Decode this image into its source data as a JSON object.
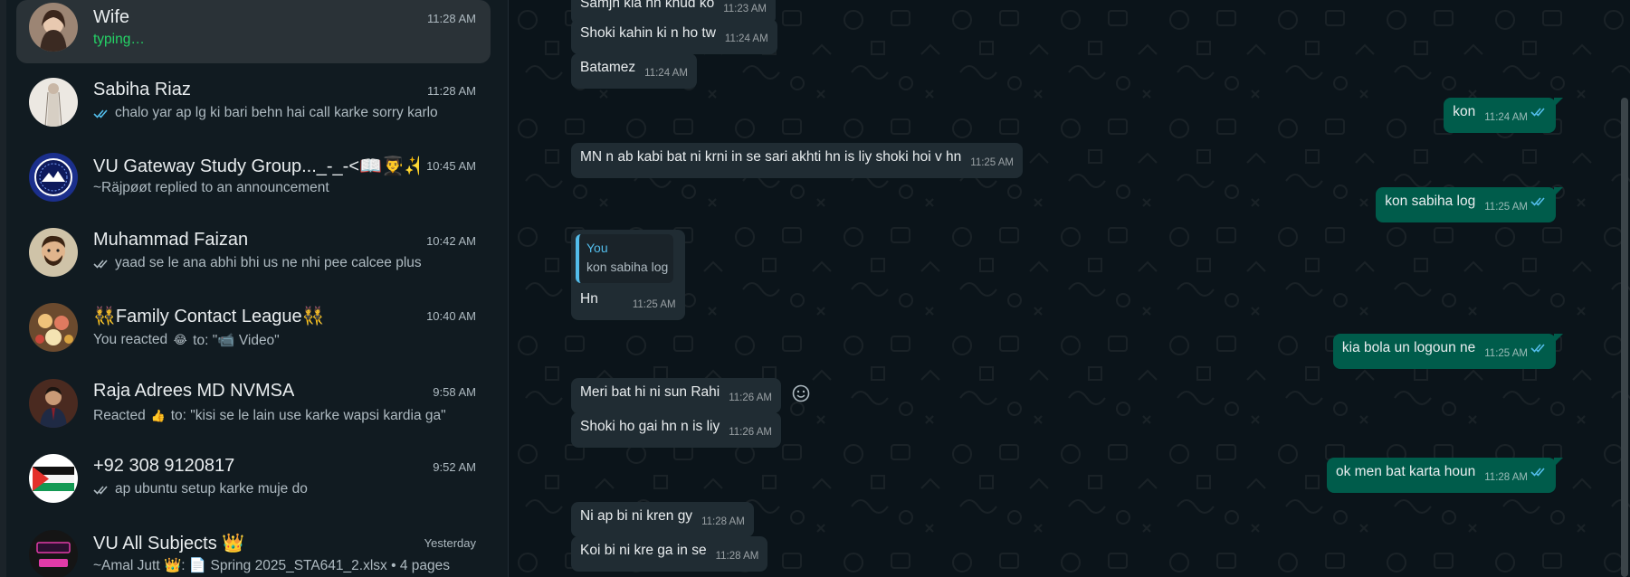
{
  "sidebar": {
    "chats": [
      {
        "name": "Wife",
        "time": "11:28 AM",
        "preview": "typing…",
        "typing": true,
        "ticks": false
      },
      {
        "name": "Sabiha Riaz",
        "time": "11:28 AM",
        "preview": "chalo yar ap lg ki bari behn hai call karke sorry karlo",
        "ticks": true,
        "tick_color": "#53bdeb"
      },
      {
        "name": "VU Gateway Study Group..._-_-<📖👨‍🎓✨...",
        "time": "10:45 AM",
        "preview": "~Räjpøøt replied to an announcement",
        "ticks": false
      },
      {
        "name": "Muhammad Faizan",
        "time": "10:42 AM",
        "preview": "yaad se le ana abhi bhi us ne nhi pee calcee plus",
        "ticks": true,
        "tick_color": "#aebac1"
      },
      {
        "name": "👯Family Contact League👯",
        "time": "10:40 AM",
        "preview_prefix": "You reacted",
        "preview_emoji": "😂",
        "preview_suffix": "to: \"📹 Video\"",
        "ticks": false
      },
      {
        "name": "Raja Adrees MD NVMSA",
        "time": "9:58 AM",
        "preview_prefix": "Reacted",
        "preview_emoji": "👍",
        "preview_suffix": "to: \"kisi se le lain use karke wapsi kardia ga\"",
        "ticks": false
      },
      {
        "name": "+92 308 9120817",
        "time": "9:52 AM",
        "preview": "ap ubuntu setup karke muje do",
        "ticks": true,
        "tick_color": "#aebac1"
      },
      {
        "name": "VU All Subjects 👑",
        "time": "Yesterday",
        "preview": "~Amal Jutt 👑: 📄 Spring 2025_STA641_2.xlsx • 4 pages",
        "ticks": false
      }
    ]
  },
  "conversation": {
    "messages": [
      {
        "dir": "in",
        "text": "Samjh kia hn khud ko",
        "time": "11:23 AM"
      },
      {
        "dir": "in",
        "text": "Shoki kahin ki n ho tw",
        "time": "11:24 AM"
      },
      {
        "dir": "in",
        "text": "Batamez",
        "time": "11:24 AM"
      },
      {
        "dir": "out",
        "text": "kon",
        "time": "11:24 AM"
      },
      {
        "dir": "in",
        "text": "MN n ab kabi bat ni krni in se sari akhti hn is liy shoki hoi v hn",
        "time": "11:25 AM"
      },
      {
        "dir": "out",
        "text": "kon sabiha log",
        "time": "11:25 AM"
      },
      {
        "dir": "in",
        "quote_author": "You",
        "quote_text": "kon sabiha log",
        "text": "Hn",
        "time": "11:25 AM"
      },
      {
        "dir": "out",
        "text": "kia bola un logoun ne",
        "time": "11:25 AM"
      },
      {
        "dir": "in",
        "text": "Meri bat hi ni sun Rahi",
        "time": "11:26 AM"
      },
      {
        "dir": "in",
        "text": "Shoki ho gai hn n is liy",
        "time": "11:26 AM"
      },
      {
        "dir": "out",
        "text": "ok men bat karta houn",
        "time": "11:28 AM"
      },
      {
        "dir": "in",
        "text": "Ni ap bi ni kren gy",
        "time": "11:28 AM"
      },
      {
        "dir": "in",
        "text": "Koi bi ni kre ga in se",
        "time": "11:28 AM"
      }
    ]
  },
  "colors": {
    "incoming_bubble": "#202c33",
    "outgoing_bubble": "#005c4b",
    "read_ticks": "#53bdeb",
    "typing": "#25d366"
  }
}
